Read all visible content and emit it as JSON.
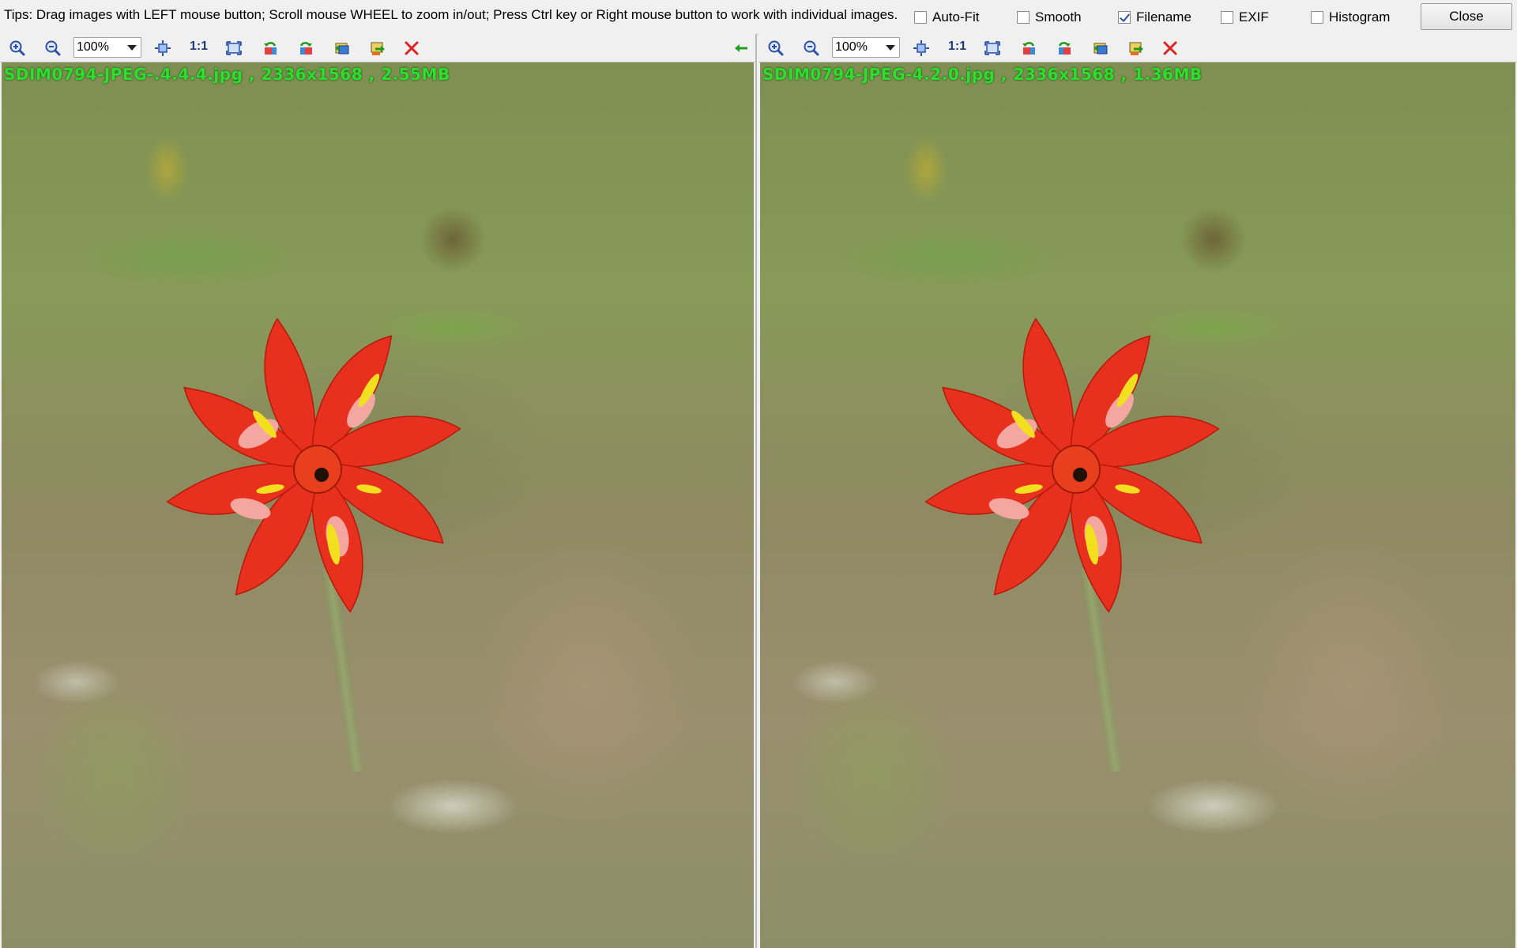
{
  "topbar": {
    "tips": "Tips: Drag images with LEFT mouse button; Scroll mouse WHEEL to zoom in/out; Press Ctrl key or Right mouse button to work with individual images.",
    "options": [
      {
        "label": "Auto-Fit",
        "checked": false
      },
      {
        "label": "Smooth",
        "checked": false
      },
      {
        "label": "Filename",
        "checked": true
      },
      {
        "label": "EXIF",
        "checked": false
      },
      {
        "label": "Histogram",
        "checked": false
      }
    ],
    "close_label": "Close"
  },
  "left_pane": {
    "zoom": "100%",
    "one_to_one": "1:1",
    "filename_overlay": "SDIM0794-JPEG-.4.4.4.jpg , 2336x1568 , 2.55MB"
  },
  "right_pane": {
    "zoom": "100%",
    "one_to_one": "1:1",
    "filename_overlay": "SDIM0794-JPEG-4.2.0.jpg , 2336x1568 , 1.36MB"
  },
  "colors": {
    "filename_text": "#2ee02e",
    "close_icon": "#e02020",
    "sync_arrow": "#1fa01f"
  },
  "icons": [
    "zoom-in-icon",
    "zoom-out-icon",
    "fit-icon",
    "fullscreen-icon",
    "rotate-left-icon",
    "rotate-right-icon",
    "prev-image-icon",
    "next-image-icon",
    "close-image-icon",
    "sync-arrow-icon"
  ]
}
